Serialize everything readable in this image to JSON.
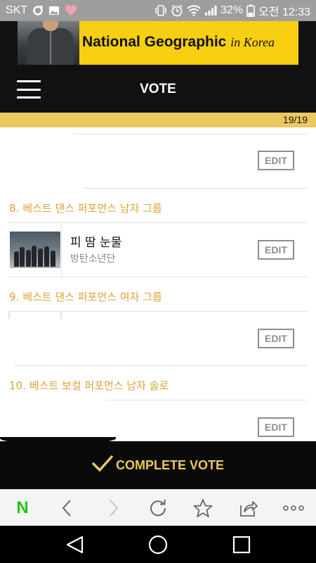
{
  "status_bar": {
    "carrier": "SKT",
    "battery": "32%",
    "time": "오전 12:33",
    "icons": [
      "o-ring-icon",
      "gallery-icon",
      "heart-icon",
      "vibrate-icon",
      "alarm-icon",
      "wifi-icon",
      "signal-icon",
      "battery-icon"
    ]
  },
  "ad": {
    "brand": "National Geographic",
    "script_text": "in Korea",
    "background": "#f7cf10"
  },
  "header": {
    "title": "VOTE",
    "menu_icon": "hamburger-menu-icon"
  },
  "progress": {
    "count": "19/19",
    "fraction": 1.0
  },
  "vote_items": [
    {
      "number": "",
      "category": "",
      "edit_label": "EDIT"
    },
    {
      "number": "8.",
      "category": "베스트 댄스 퍼포먼스 남자 그룹",
      "song": "피 땀 눈물",
      "artist": "방탄소년단",
      "edit_label": "EDIT"
    },
    {
      "number": "9.",
      "category": "베스트 댄스 퍼포먼스 여자 그룹",
      "edit_label": "EDIT"
    },
    {
      "number": "10.",
      "category": "베스트 보컬 퍼포먼스 남자 솔로",
      "edit_label": "EDIT"
    }
  ],
  "complete": {
    "label": "COMPLETE VOTE",
    "icon": "checkmark-icon"
  },
  "browser": {
    "logo": "N",
    "icons": [
      "naver-logo",
      "back-icon",
      "forward-icon",
      "refresh-icon",
      "star-icon",
      "share-icon",
      "more-icon"
    ]
  },
  "system_nav": {
    "icons": [
      "back-triangle-icon",
      "home-circle-icon",
      "recents-square-icon"
    ]
  },
  "colors": {
    "accent": "#dba33a",
    "progress": "#ecc860",
    "dark": "#111111",
    "naver_green": "#1ec800"
  }
}
